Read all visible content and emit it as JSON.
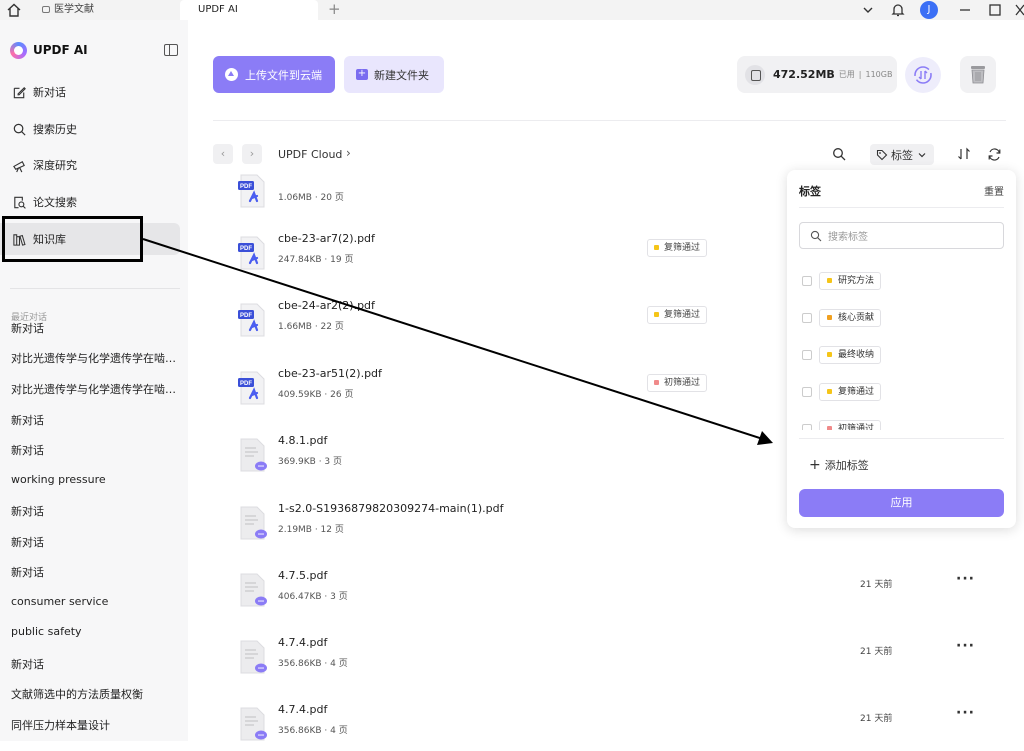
{
  "titlebar": {
    "tabs": [
      {
        "label": "医学文献"
      },
      {
        "label": "UPDF AI"
      }
    ],
    "avatar_initial": "J"
  },
  "sidebar": {
    "brand": "UPDF AI",
    "items": [
      {
        "label": "新对话",
        "icon": "edit-icon"
      },
      {
        "label": "搜索历史",
        "icon": "search-icon"
      },
      {
        "label": "深度研究",
        "icon": "telescope-icon"
      },
      {
        "label": "论文搜索",
        "icon": "doc-search-icon"
      },
      {
        "label": "知识库",
        "icon": "books-icon"
      }
    ],
    "recent_title": "最近对话",
    "recent": [
      "新对话",
      "对比光遗传学与化学遗传学在啮…",
      "对比光遗传学与化学遗传学在啮…",
      "新对话",
      "新对话",
      "working pressure",
      "新对话",
      "新对话",
      "新对话",
      "consumer service",
      "public safety",
      "新对话",
      "文献筛选中的方法质量权衡",
      "同伴压力样本量设计"
    ]
  },
  "toolbar": {
    "upload_label": "上传文件到云端",
    "new_folder_label": "新建文件夹",
    "storage_used": "472.52MB",
    "storage_used_label": "已用",
    "storage_total": "110GB"
  },
  "breadcrumb": {
    "root": "UPDF Cloud"
  },
  "tag_filter_label": "标签",
  "files": [
    {
      "name": "",
      "meta": "1.06MB · 20 页",
      "type": "pdf",
      "tag": null,
      "time": ""
    },
    {
      "name": "cbe-23-ar7(2).pdf",
      "meta": "247.84KB · 19 页",
      "type": "pdf",
      "tag": {
        "label": "复筛通过",
        "color": "#f5c518"
      },
      "time": ""
    },
    {
      "name": "cbe-24-ar2(2).pdf",
      "meta": "1.66MB · 22 页",
      "type": "pdf",
      "tag": {
        "label": "复筛通过",
        "color": "#f5c518"
      },
      "time": ""
    },
    {
      "name": "cbe-23-ar51(2).pdf",
      "meta": "409.59KB · 26 页",
      "type": "pdf",
      "tag": {
        "label": "初筛通过",
        "color": "#f08a8a"
      },
      "time": ""
    },
    {
      "name": "4.8.1.pdf",
      "meta": "369.9KB · 3 页",
      "type": "doc",
      "tag": null,
      "time": ""
    },
    {
      "name": "1-s2.0-S1936879820309274-main(1).pdf",
      "meta": "2.19MB · 12 页",
      "type": "doc",
      "tag": null,
      "time": ""
    },
    {
      "name": "4.7.5.pdf",
      "meta": "406.47KB · 3 页",
      "type": "doc",
      "tag": null,
      "time": "21 天前"
    },
    {
      "name": "4.7.4.pdf",
      "meta": "356.86KB · 4 页",
      "type": "doc",
      "tag": null,
      "time": "21 天前"
    },
    {
      "name": "4.7.4.pdf",
      "meta": "356.86KB · 4 页",
      "type": "doc",
      "tag": null,
      "time": "21 天前"
    }
  ],
  "tag_panel": {
    "title": "标签",
    "reset": "重置",
    "search_placeholder": "搜索标签",
    "tags": [
      {
        "label": "研究方法",
        "color": "#f5c518"
      },
      {
        "label": "核心贡献",
        "color": "#f0a020"
      },
      {
        "label": "最终收纳",
        "color": "#f5c518"
      },
      {
        "label": "复筛通过",
        "color": "#f5c518"
      },
      {
        "label": "初筛通过",
        "color": "#f08a8a"
      }
    ],
    "add_label": "添加标签",
    "apply_label": "应用"
  }
}
